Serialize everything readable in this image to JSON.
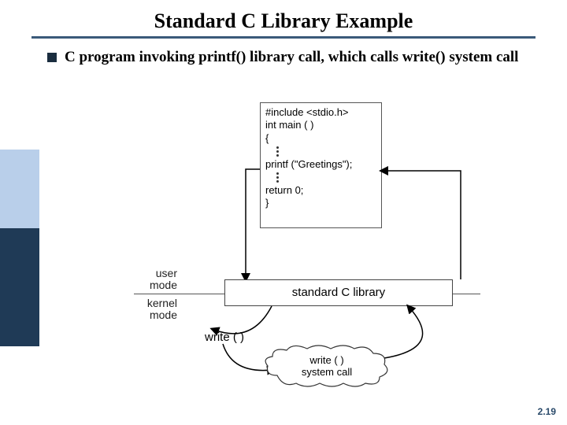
{
  "title": "Standard C Library Example",
  "bullet": "C program invoking printf() library call, which calls write() system call",
  "code": {
    "include": "#include <stdio.h>",
    "main": "int main ( )",
    "open": "{",
    "printf": " printf (\"Greetings\");",
    "ret": " return 0;",
    "close": "}"
  },
  "lib_label": "standard C library",
  "mode": {
    "user_l1": "user",
    "user_l2": "mode",
    "kernel_l1": "kernel",
    "kernel_l2": "mode"
  },
  "write_fn": "write ( )",
  "cloud": {
    "l1": "write ( )",
    "l2": "system call"
  },
  "page": "2.19"
}
